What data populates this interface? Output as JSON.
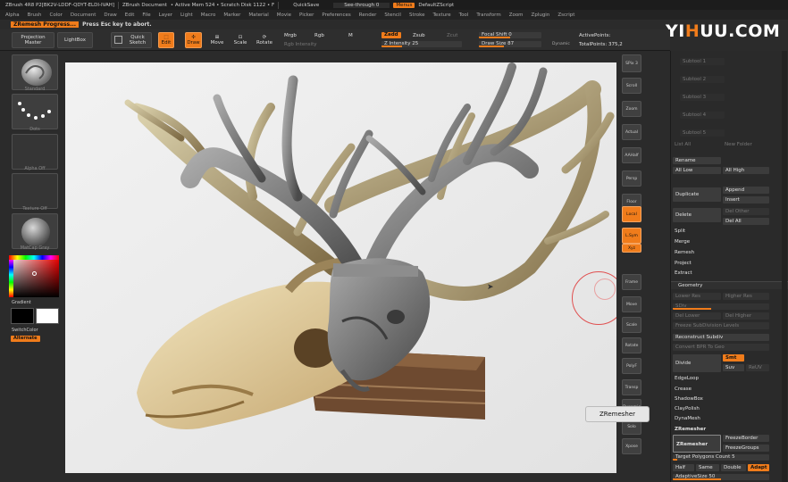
{
  "titlebar": {
    "app": "ZBrush 4R8 P2[BK2V-LDDF-QDYT-ELDI-IVAH]",
    "document": "ZBrush Document",
    "mem": "• Active Mem 524 • Scratch Disk 1122 • F",
    "quicksave": "QuickSave",
    "seethrough": "See-through 0",
    "menus": "Menus",
    "script": "DefaultZScript"
  },
  "menubar": [
    "Alpha",
    "Brush",
    "Color",
    "Document",
    "Draw",
    "Edit",
    "File",
    "Layer",
    "Light",
    "Macro",
    "Marker",
    "Material",
    "Movie",
    "Picker",
    "Preferences",
    "Render",
    "Stencil",
    "Stroke",
    "Texture",
    "Tool",
    "Transform",
    "Zoom",
    "Zplugin",
    "Zscript"
  ],
  "status": {
    "tag": "ZRemesh Progress...",
    "message": "Press Esc key to abort."
  },
  "toolbar": {
    "projection_master": "Projection Master",
    "lightbox": "LightBox",
    "quick_sketch": "Quick Sketch",
    "edit": "Edit",
    "draw": "Draw",
    "move": "Move",
    "scale": "Scale",
    "rotate": "Rotate",
    "mrgb": "Mrgb",
    "rgb": "Rgb",
    "m": "M",
    "rgb_intensity": "Rgb Intensity",
    "zadd": "Zadd",
    "zsub": "Zsub",
    "zcut": "Zcut",
    "z_intensity": "Z Intensity 25",
    "focal_shift": "Focal Shift 0",
    "draw_size": "Draw Size 87",
    "dynamic": "Dynamic",
    "active_points": "ActivePoints:",
    "total_points": "TotalPoints: 375,2"
  },
  "left_shelf": {
    "gradient": "Gradient",
    "switch_color": "SwitchColor",
    "alternate": "Alternate",
    "brush_label": "Standard",
    "stroke_label": "Dots",
    "alpha_label": "Alpha Off",
    "texture_label": "Texture Off",
    "material_label": "MatCap Gray"
  },
  "right_shelf": [
    "SPix 3",
    "Scroll",
    "Zoom",
    "Actual",
    "AAHalf",
    "Persp",
    "Floor",
    "Local",
    "L.Sym",
    "Xyz",
    "Frame",
    "Move",
    "Scale",
    "Rotate",
    "PolyF",
    "Transp",
    "Dynamic",
    "Solo",
    "Xpose"
  ],
  "palette": {
    "rename": "Rename",
    "all_low": "All Low",
    "all_high": "All High",
    "duplicate": "Duplicate",
    "append": "Append",
    "insert": "Insert",
    "delete": "Delete",
    "del_other": "Del Other",
    "del_all": "Del All",
    "split": "Split",
    "merge": "Merge",
    "remesh": "Remesh",
    "project": "Project",
    "extract": "Extract",
    "geometry": "Geometry",
    "lower_res": "Lower Res",
    "higher_res": "Higher Res",
    "sdiv": "SDiv",
    "del_lower": "Del Lower",
    "del_higher": "Del Higher",
    "freeze_subdiv": "Freeze SubDivision Levels",
    "reconstruct_subdiv": "Reconstruct Subdiv",
    "convert_bpr": "Convert BPR To Geo",
    "divide": "Divide",
    "smt": "Smt",
    "suv": "Suv",
    "reuv": "ReUV",
    "edgeloop": "EdgeLoop",
    "crease": "Crease",
    "shadowbox": "ShadowBox",
    "claypolish": "ClayPolish",
    "dynamesh": "DynaMesh",
    "zremesher_header": "ZRemesher",
    "zremesher_btn": "ZRemesher",
    "freeze_border": "FreezeBorder",
    "freeze_groups": "FreezeGroups",
    "target_polygons": "Target Polygons Count 5",
    "half": "Half",
    "same": "Same",
    "double": "Double",
    "adapt": "Adapt",
    "adaptive_size": "AdaptiveSize 50",
    "tool_list": [
      "Subtool 1",
      "Subtool 2",
      "Subtool 3",
      "Subtool 4",
      "Subtool 5"
    ],
    "list_all": "List All",
    "new_folder": "New Folder"
  },
  "tooltip": "ZRemesher",
  "watermark": {
    "a": "YI",
    "b": "H",
    "c": "UU.COM"
  },
  "colors": {
    "accent": "#f07c1b",
    "panel": "#2b2b2b",
    "viewport_bg": "#ececec"
  }
}
